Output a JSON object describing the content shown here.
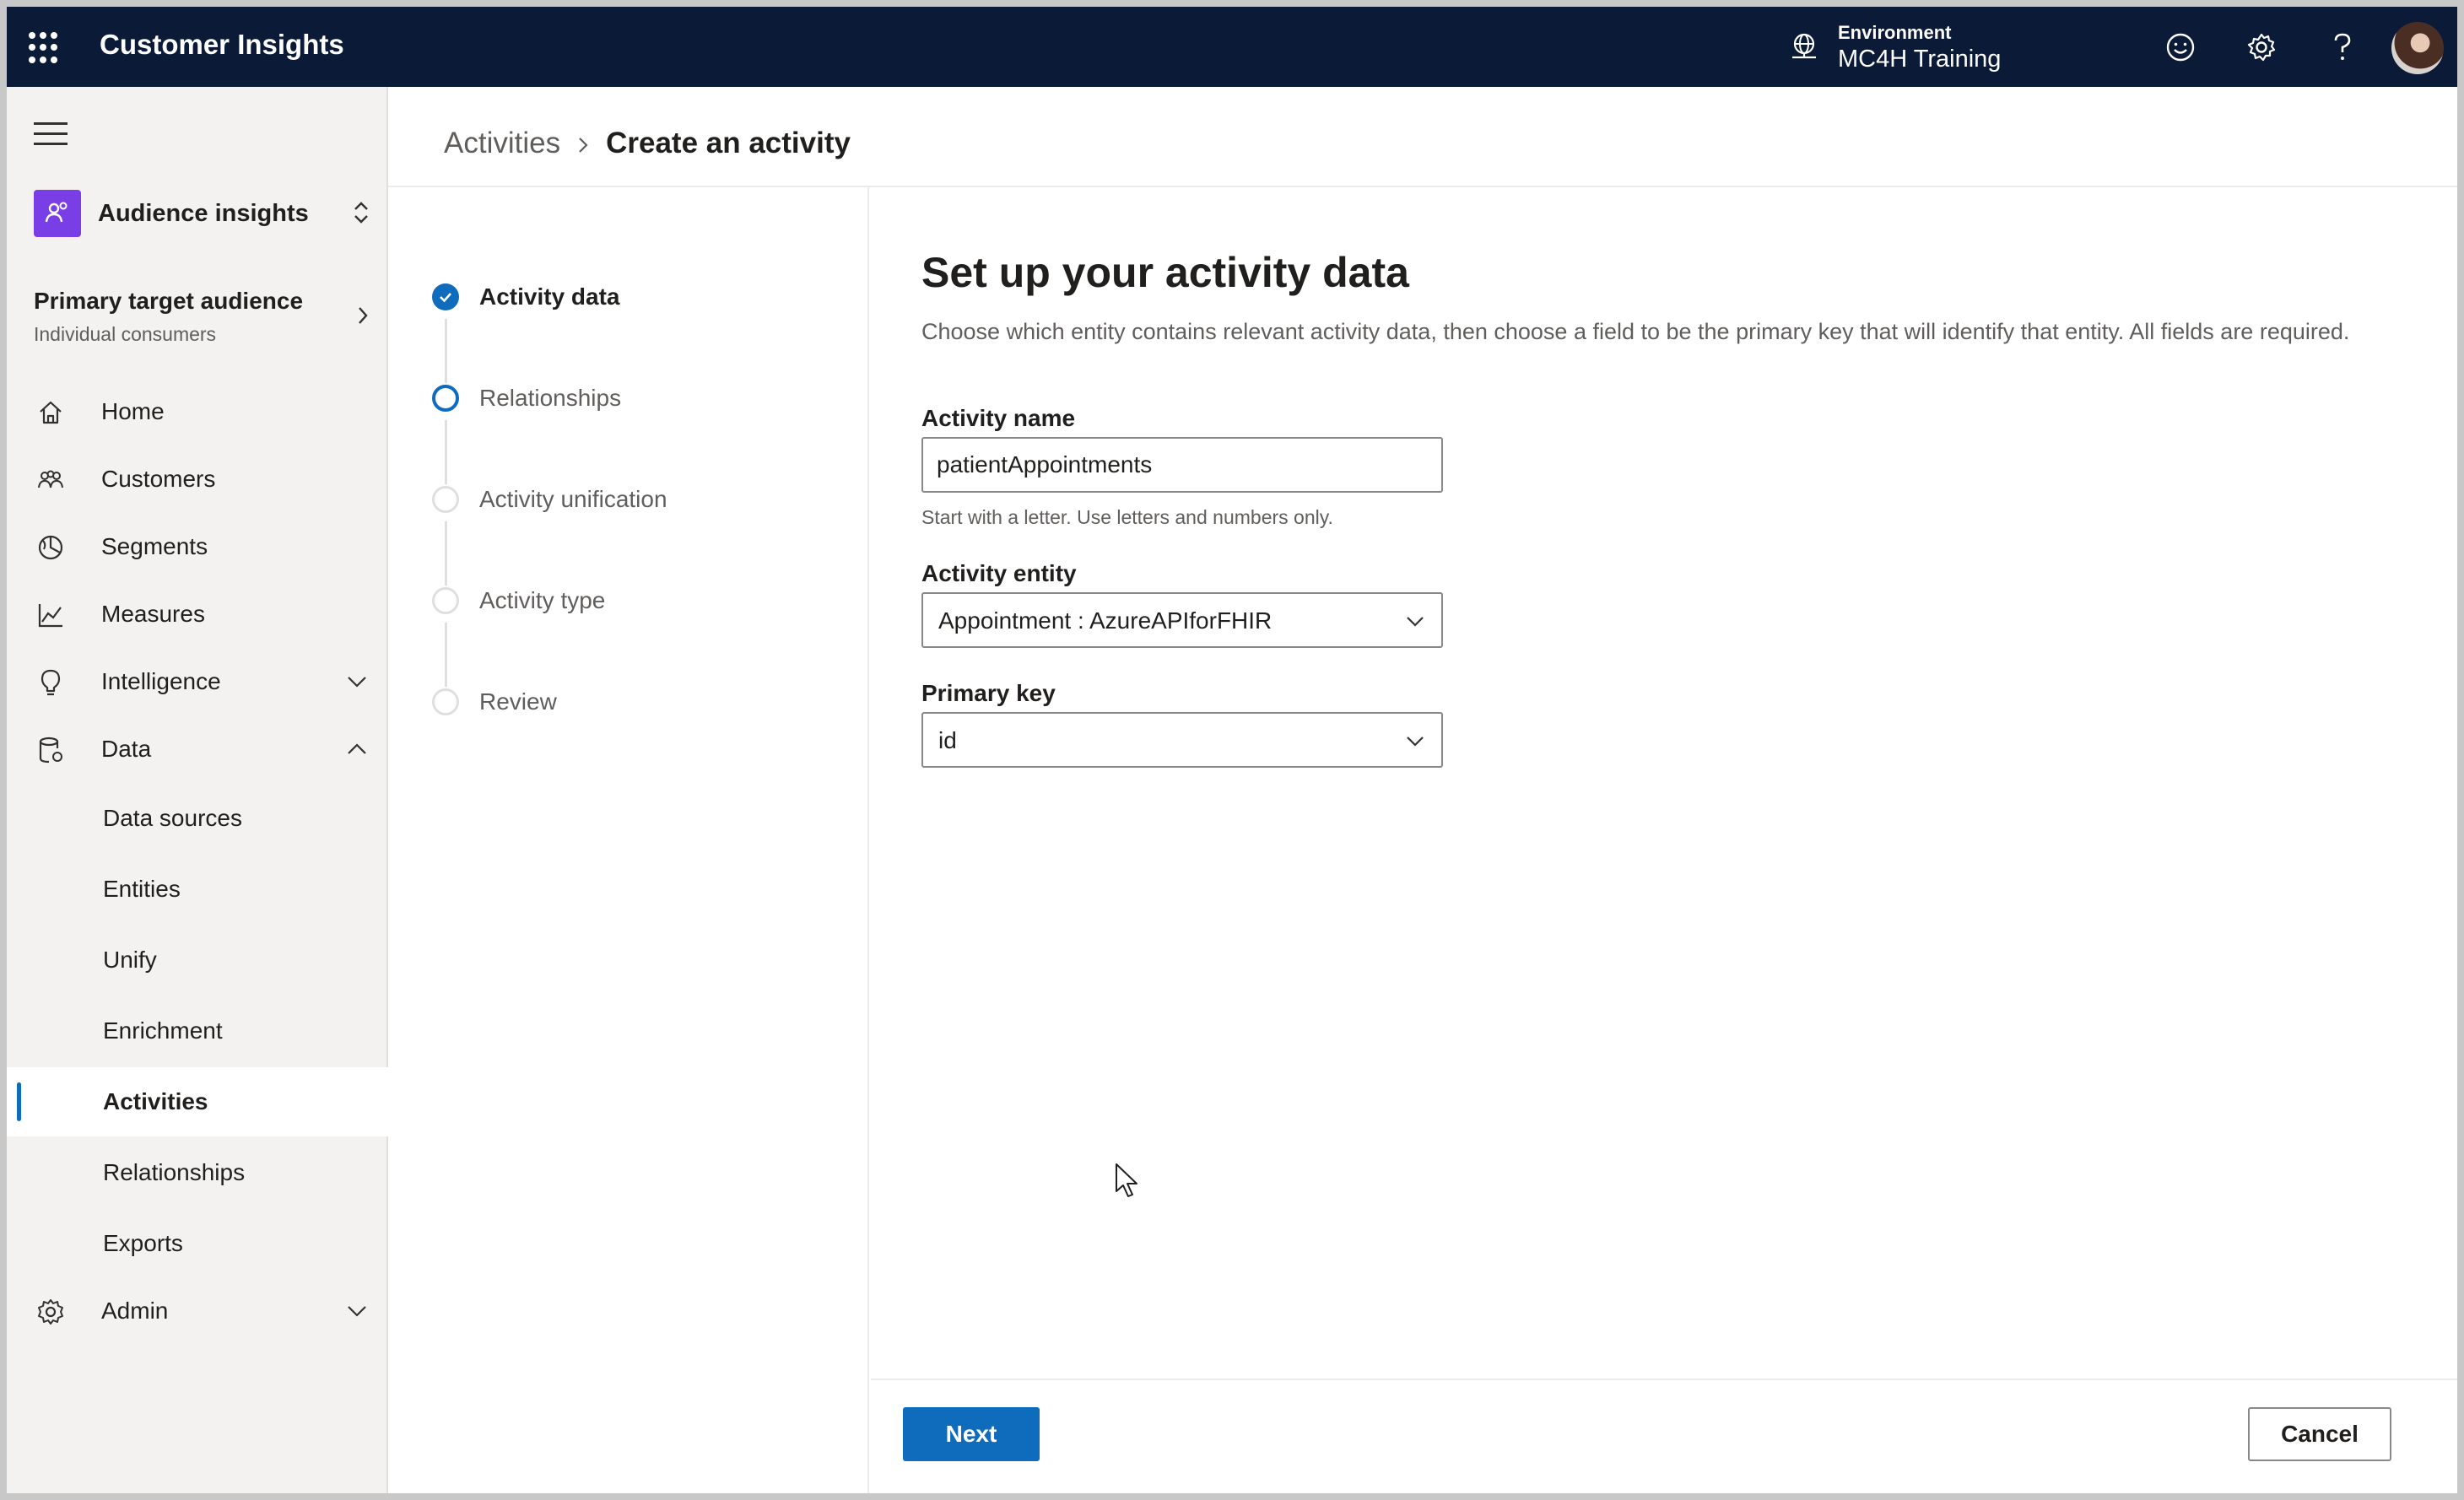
{
  "topbar": {
    "app_title": "Customer Insights",
    "environment_label": "Environment",
    "environment_value": "MC4H Training",
    "icons": [
      "waffle-icon",
      "environment-icon",
      "feedback-smiley-icon",
      "settings-gear-icon",
      "help-icon"
    ]
  },
  "sidebar": {
    "app_switcher_label": "Audience insights",
    "audience_title": "Primary target audience",
    "audience_sub": "Individual consumers",
    "items": [
      {
        "label": "Home",
        "icon": "home-icon"
      },
      {
        "label": "Customers",
        "icon": "customers-icon"
      },
      {
        "label": "Segments",
        "icon": "segments-icon"
      },
      {
        "label": "Measures",
        "icon": "measures-icon"
      },
      {
        "label": "Intelligence",
        "icon": "lightbulb-icon"
      },
      {
        "label": "Data",
        "icon": "data-icon"
      }
    ],
    "data_subitems": [
      "Data sources",
      "Entities",
      "Unify",
      "Enrichment",
      "Activities",
      "Relationships",
      "Exports"
    ],
    "active_item": "Activities",
    "admin_label": "Admin"
  },
  "breadcrumb": {
    "parent": "Activities",
    "current": "Create an activity"
  },
  "steps": [
    {
      "label": "Activity data",
      "state": "done"
    },
    {
      "label": "Relationships",
      "state": "current"
    },
    {
      "label": "Activity unification",
      "state": "pending"
    },
    {
      "label": "Activity type",
      "state": "pending"
    },
    {
      "label": "Review",
      "state": "pending"
    }
  ],
  "form": {
    "title": "Set up your activity data",
    "description": "Choose which entity contains relevant activity data, then choose a field to be the primary key that will identify that entity. All fields are required.",
    "activity_name_label": "Activity name",
    "activity_name_value": "patientAppointments",
    "activity_name_hint": "Start with a letter. Use letters and numbers only.",
    "activity_entity_label": "Activity entity",
    "activity_entity_value": "Appointment : AzureAPIforFHIR",
    "primary_key_label": "Primary key",
    "primary_key_value": "id"
  },
  "footer": {
    "next_label": "Next",
    "cancel_label": "Cancel"
  },
  "colors": {
    "topbar": "#0b1a37",
    "accent": "#0f6cbd",
    "app_tile": "#7a3ee6"
  }
}
